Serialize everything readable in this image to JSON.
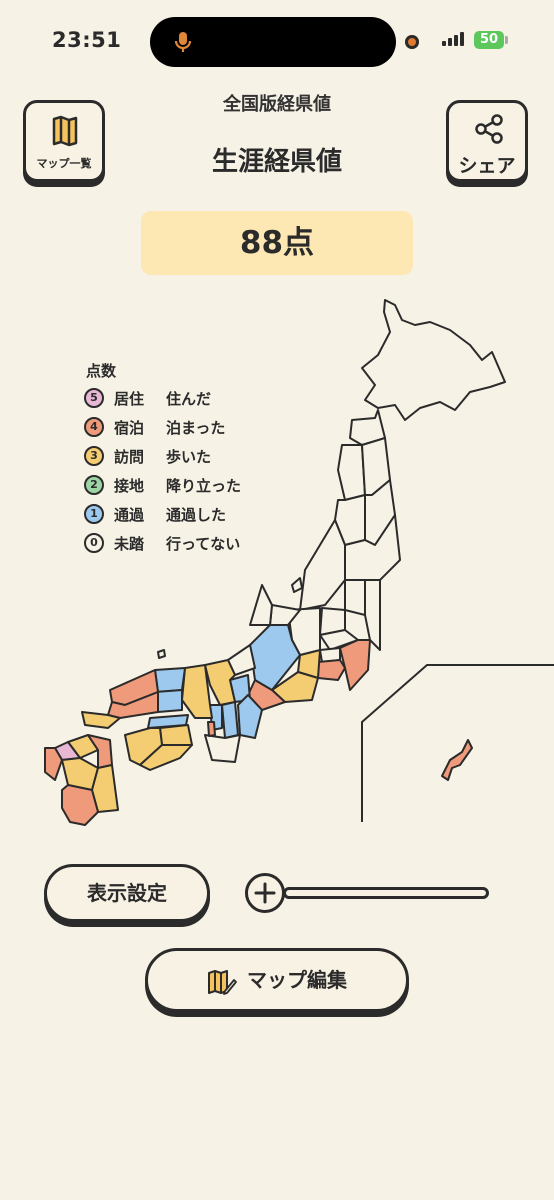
{
  "status": {
    "time": "23:51",
    "battery": "50"
  },
  "header": {
    "subtitle": "全国版経県値",
    "title": "生涯経県値",
    "map_list_label": "マップ一覧",
    "share_label": "シェア"
  },
  "score": "88点",
  "legend": {
    "title": "点数",
    "items": [
      {
        "num": "5",
        "kind": "居住",
        "desc": "住んだ",
        "color": "#e7b7d4"
      },
      {
        "num": "4",
        "kind": "宿泊",
        "desc": "泊まった",
        "color": "#ef9b7b"
      },
      {
        "num": "3",
        "kind": "訪問",
        "desc": "歩いた",
        "color": "#f4cd72"
      },
      {
        "num": "2",
        "kind": "接地",
        "desc": "降り立った",
        "color": "#9ed5a5"
      },
      {
        "num": "1",
        "kind": "通過",
        "desc": "通過した",
        "color": "#9dc9ee"
      },
      {
        "num": "0",
        "kind": "未踏",
        "desc": "行ってない",
        "color": "#f7f2e6"
      }
    ]
  },
  "controls": {
    "display_settings": "表示設定",
    "map_edit": "マップ編集"
  },
  "colors": {
    "background": "#f7f2e6",
    "score_bg": "#fde7b2",
    "outline": "#2b2b2b"
  }
}
